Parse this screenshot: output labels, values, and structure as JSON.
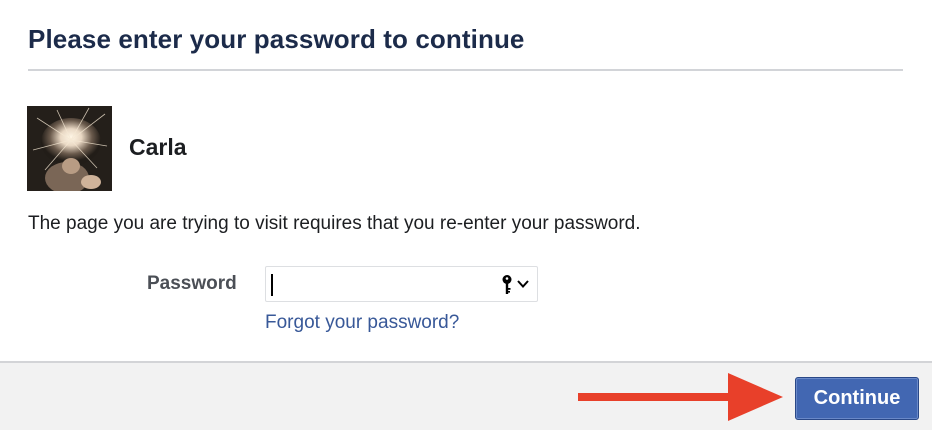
{
  "dialog": {
    "title": "Please enter your password to continue"
  },
  "user": {
    "name": "Carla",
    "avatar_icon": "profile-photo"
  },
  "message": "The page you are trying to visit requires that you re-enter your password.",
  "password": {
    "label": "Password",
    "value": "",
    "key_icon": "key-icon",
    "chevron_icon": "chevron-down-icon"
  },
  "forgot_link": "Forgot your password?",
  "footer": {
    "continue_label": "Continue",
    "annotation_icon": "red-arrow-icon"
  },
  "colors": {
    "title": "#1c2b4a",
    "link": "#385898",
    "button": "#4267b2",
    "arrow": "#e8402a",
    "footer_bg": "#f2f2f2"
  }
}
